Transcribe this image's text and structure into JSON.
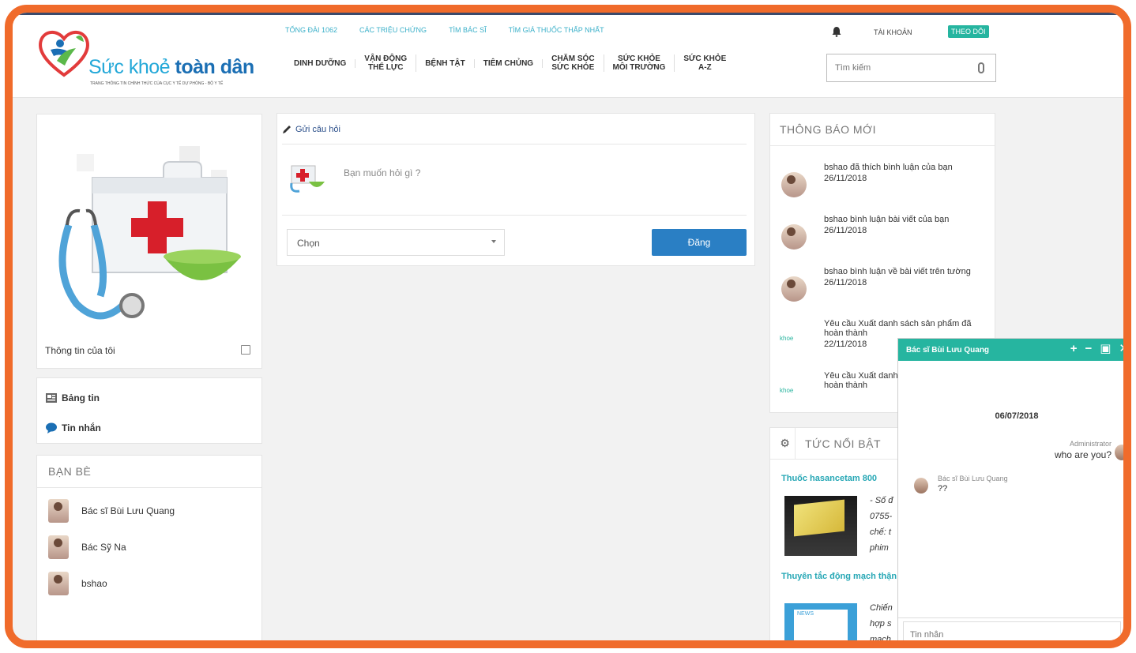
{
  "brand": {
    "name_part1": "Sức khoẻ",
    "name_part2": "toàn dân",
    "tagline": "TRANG THÔNG TIN CHÍNH THỨC CỦA CỤC Y TẾ DỰ PHÒNG - BỘ Y TẾ"
  },
  "header": {
    "top_links": [
      "TỔNG ĐÀI 1062",
      "CÁC TRIỆU CHỨNG",
      "TÌM BÁC SĨ",
      "TÌM GIÁ THUỐC THẤP NHẤT"
    ],
    "account_label": "TÀI KHOẢN",
    "follow_label": "THEO DÕI",
    "nav": [
      "DINH DƯỠNG",
      "VẬN ĐỘNG\nTHỂ LỰC",
      "BỆNH TẬT",
      "TIÊM CHỦNG",
      "CHĂM SÓC\nSỨC KHỎE",
      "SỨC KHỎE\nMÔI TRƯỜNG",
      "SỨC KHỎE\nA-Z"
    ],
    "search_placeholder": "Tìm kiếm"
  },
  "left": {
    "profile_label": "Thông tin của tôi",
    "menu": [
      "Bảng tin",
      "Tin nhắn"
    ],
    "friends_title": "BẠN BÈ",
    "friends": [
      "Bác sĩ Bùi Lưu Quang",
      "Bác Sỹ Na",
      "bshao"
    ]
  },
  "post": {
    "header": "Gửi câu hỏi",
    "placeholder": "Bạn muốn hỏi gì ?",
    "select_value": "Chọn",
    "submit_label": "Đăng"
  },
  "notifications": {
    "title": "THÔNG BÁO MỚI",
    "items": [
      {
        "text": "bshao đã thích bình luận của bạn",
        "date": "26/11/2018"
      },
      {
        "text": "bshao bình luận bài viết của bạn",
        "date": "26/11/2018"
      },
      {
        "text": "bshao bình luận về bài viết trên tường",
        "date": "26/11/2018"
      },
      {
        "text": "Yêu cầu Xuất danh sách sản phẩm đã hoàn thành",
        "date": "22/11/2018"
      },
      {
        "text": "Yêu cầu Xuất danh sách sản phẩm đã hoàn thành",
        "date": ""
      }
    ],
    "khoe_label": "khoe"
  },
  "news": {
    "title": "TỨC NỔI BẬT",
    "items": [
      {
        "title": "Thuốc hasancetam 800",
        "snippet": [
          "- Số đ",
          "0755-",
          "chế: t",
          "phim"
        ]
      },
      {
        "title": "Thuyên tắc động mạch thận",
        "snippet": [
          "Chiến",
          "hợp s",
          "mạch"
        ]
      }
    ],
    "img2_label": "NEWS"
  },
  "chat": {
    "title": "Bác sĩ Bùi Lưu Quang",
    "controls": [
      "+",
      "−",
      "▣",
      "✕"
    ],
    "date": "06/07/2018",
    "messages": [
      {
        "sender": "Administrator",
        "text": "who are you?"
      },
      {
        "sender": "Bác sĩ Bùi Lưu Quang",
        "text": "??"
      }
    ],
    "input_placeholder": "Tin nhắn"
  },
  "colors": {
    "frame": "#f06b2b",
    "accent": "#26b5a0",
    "primary_button": "#2a7fc4",
    "link": "#26a7b5"
  }
}
